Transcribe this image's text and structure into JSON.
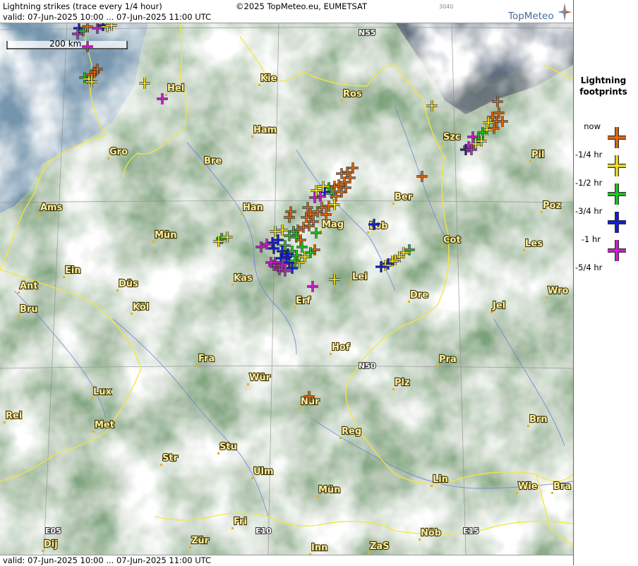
{
  "header": {
    "title": "Lightning strikes (trace every 1/4 hour)",
    "copyright": "©2025 TopMeteo.eu, EUMETSAT",
    "code": "3040",
    "valid": "valid:  07-Jun-2025 10:00 ... 07-Jun-2025 11:00 UTC",
    "brand": "TopMeteo"
  },
  "footer": {
    "valid": "valid:  07-Jun-2025 10:00 ... 07-Jun-2025 11:00 UTC"
  },
  "scale_bar": {
    "label": "200 km"
  },
  "legend": {
    "title_line1": "Lightning",
    "title_line2": "footprints",
    "items": [
      {
        "label": "now",
        "color": "#e06a10"
      },
      {
        "label": "-1/4 hr",
        "color": "#f0e020"
      },
      {
        "label": "-1/2 hr",
        "color": "#20c820"
      },
      {
        "label": "-3/4 hr",
        "color": "#1020d0"
      },
      {
        "label": "-1 hr",
        "color": "#d020d0"
      },
      {
        "label": "-5/4 hr",
        "color": ""
      }
    ]
  },
  "grid_labels": [
    "N55",
    "N50",
    "E05",
    "E10",
    "E15"
  ],
  "cities": [
    "Hel",
    "Kie",
    "Ros",
    "Ham",
    "Gro",
    "Bre",
    "Szc",
    "Pil",
    "Ams",
    "Han",
    "Ber",
    "Poz",
    "Mün",
    "Mag",
    "Lob",
    "Cot",
    "Les",
    "Ein",
    "Kas",
    "Lei",
    "Ant",
    "Düs",
    "Wro",
    "Bru",
    "Köl",
    "Erf",
    "Dre",
    "Jel",
    "Hof",
    "Fra",
    "Pra",
    "Lux",
    "Wür",
    "Plz",
    "Rei",
    "Nür",
    "Met",
    "Brn",
    "Reg",
    "Str",
    "Stu",
    "Ulm",
    "Lin",
    "Mün",
    "Wie",
    "Bra",
    "Fri",
    "Dij",
    "Zür",
    "Inn",
    "ZaS",
    "Nöb"
  ]
}
